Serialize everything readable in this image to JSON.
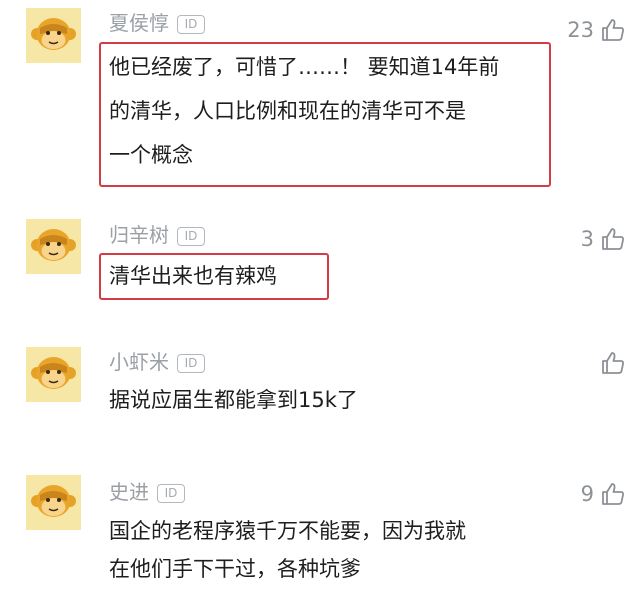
{
  "comments": [
    {
      "username": "夏侯惇",
      "id_badge": "ID",
      "likes": "23",
      "lines": [
        "他已经废了，可惜了……！ 要知道14年前",
        "的清华，人口比例和现在的清华可不是",
        "一个概念"
      ]
    },
    {
      "username": "归辛树",
      "id_badge": "ID",
      "likes": "3",
      "lines": [
        "清华出来也有辣鸡"
      ]
    },
    {
      "username": "小虾米",
      "id_badge": "ID",
      "likes": "",
      "lines": [
        "据说应届生都能拿到15k了"
      ]
    },
    {
      "username": "史进",
      "id_badge": "ID",
      "likes": "9",
      "lines": [
        "国企的老程序猿千万不能要，因为我就",
        "在他们手下干过，各种坑爹"
      ]
    }
  ],
  "icons": {
    "avatar": "monkey-avatar-icon",
    "like": "thumbs-up-icon"
  },
  "colors": {
    "highlight_border": "#d33b45",
    "avatar_bg": "#f6e6a2"
  }
}
